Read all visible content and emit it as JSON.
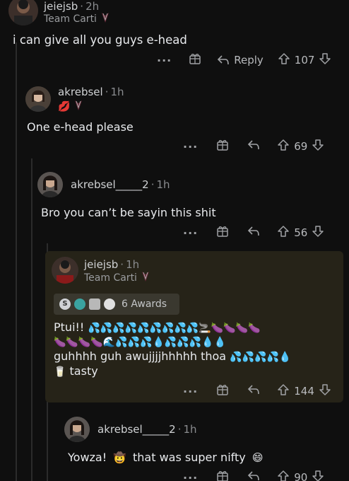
{
  "comments": [
    {
      "username": "jeiejsb",
      "time": "2h",
      "flair": "Team Carti",
      "body": "i can give all you guys e-head",
      "reply_label": "Reply",
      "votes": "107"
    },
    {
      "username": "akrebsel",
      "time": "1h",
      "body": "One e-head please",
      "votes": "69"
    },
    {
      "username": "akrebsel_____2",
      "time": "1h",
      "body": "Bro you can’t be sayin this shit",
      "votes": "56"
    },
    {
      "username": "jeiejsb",
      "time": "1h",
      "flair": "Team Carti",
      "awards_label": "6 Awards",
      "line1_text": "Ptui!!",
      "line1_emoji": "💦💦💦💦💦💦💦💦💦🚬🍆🍆🍆🍆",
      "line2_emoji": "🍆🍆🍆🍆🌊💦💦💦💧💦💦💦💧💧",
      "line3_text": "guhhhh guh awujjjjhhhhh thoa",
      "line3_emoji": "💦💦💦💦💧",
      "line4_emoji": "🥛",
      "line4_text": "tasty",
      "votes": "144"
    },
    {
      "username": "akrebsel_____2",
      "time": "1h",
      "body_start": "Yowza!",
      "body_emoji": "🤠",
      "body_mid": "that was super nifty",
      "body_end_emoji": "😄",
      "votes": "90"
    }
  ],
  "icons": {
    "more": "more-options-icon",
    "award": "award-gift-icon",
    "reply": "reply-arrow-icon",
    "upvote": "upvote-arrow-icon",
    "downvote": "downvote-arrow-icon"
  },
  "colors": {
    "background": "#0f0f0f",
    "highlight": "#262318",
    "text": "#e8eaed",
    "muted": "#8a8c8f"
  }
}
